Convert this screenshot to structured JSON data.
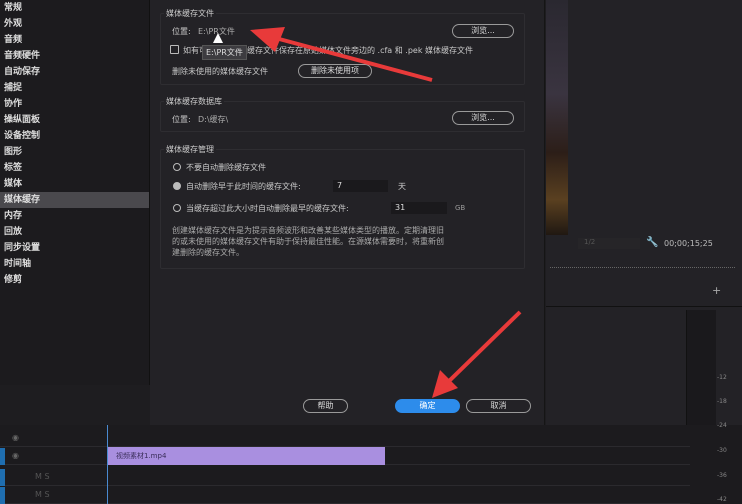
{
  "sidebar": {
    "items": [
      "常规",
      "外观",
      "音频",
      "音频硬件",
      "自动保存",
      "捕捉",
      "协作",
      "操纵面板",
      "设备控制",
      "图形",
      "标签",
      "媒体",
      "媒体缓存",
      "内存",
      "回放",
      "同步设置",
      "时间轴",
      "修剪"
    ],
    "selected": "媒体缓存"
  },
  "cache_files": {
    "title": "媒体缓存文件",
    "location_label": "位置:",
    "location_value": "E:\\PR文件",
    "browse": "浏览...",
    "tooltip": "E:\\PR文件",
    "checkbox_label": "如有可能，将媒体缓存文件保存在原始媒体文件旁边的 .cfa 和 .pek 媒体缓存文件",
    "checkbox_checked": false,
    "delete_label": "删除未使用的媒体缓存文件",
    "delete_button": "删除未使用项"
  },
  "cache_db": {
    "title": "媒体缓存数据库",
    "location_label": "位置:",
    "location_value": "D:\\缓存\\",
    "browse": "浏览..."
  },
  "cache_mgmt": {
    "title": "媒体缓存管理",
    "options": [
      "不要自动删除缓存文件",
      "自动删除早于此时间的缓存文件:",
      "当缓存超过此大小时自动删除最早的缓存文件:"
    ],
    "selected_option": 1,
    "days_value": "7",
    "days_unit": "天",
    "size_value": "31",
    "size_unit": "GB",
    "description": "创建媒体缓存文件是为提示音频波形和改善某些媒体类型的播放。定期清理旧的或未使用的媒体缓存文件有助于保持最佳性能。在源媒体需要时，将重新创建删除的缓存文件。"
  },
  "footer": {
    "help": "帮助",
    "ok": "确定",
    "cancel": "取消"
  },
  "preview": {
    "zoom": "1/2",
    "timecode": "00;00;15;25"
  },
  "timeline": {
    "clip_name": "视频素材1.mp4",
    "clip_color": "#a98fe0"
  },
  "meter": {
    "ticks": [
      "-12",
      "-18",
      "-24",
      "-30",
      "-36",
      "-42"
    ]
  },
  "colors": {
    "accent": "#2d8ceb",
    "annotation_arrow": "#e83a3a"
  }
}
